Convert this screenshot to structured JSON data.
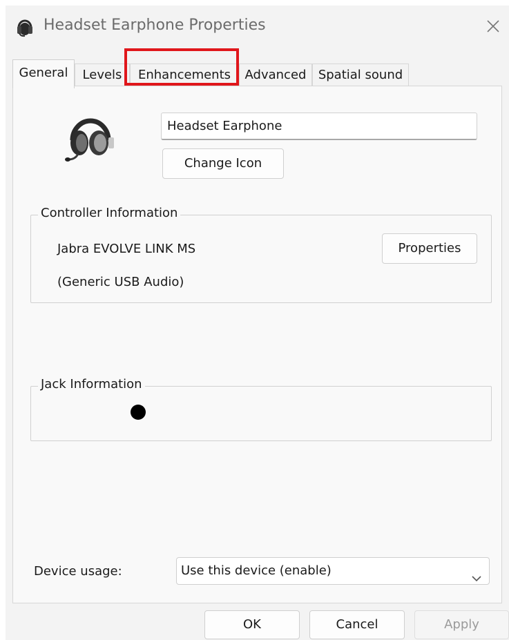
{
  "window": {
    "title": "Headset Earphone Properties",
    "close_icon": "close-icon"
  },
  "tabs": [
    {
      "label": "General",
      "active": true
    },
    {
      "label": "Levels"
    },
    {
      "label": "Enhancements",
      "highlighted": true
    },
    {
      "label": "Advanced"
    },
    {
      "label": "Spatial sound"
    }
  ],
  "general": {
    "device_name": "Headset Earphone",
    "change_icon_label": "Change Icon",
    "controller": {
      "group_label": "Controller Information",
      "name": "Jabra EVOLVE LINK MS",
      "driver": "(Generic USB Audio)",
      "properties_label": "Properties"
    },
    "jack": {
      "group_label": "Jack Information",
      "color": "#000000"
    },
    "device_usage": {
      "label": "Device usage:",
      "selected": "Use this device (enable)"
    }
  },
  "footer": {
    "ok_label": "OK",
    "cancel_label": "Cancel",
    "apply_label": "Apply"
  },
  "colors": {
    "highlight": "#e0161b",
    "background": "#f3f3f3"
  }
}
